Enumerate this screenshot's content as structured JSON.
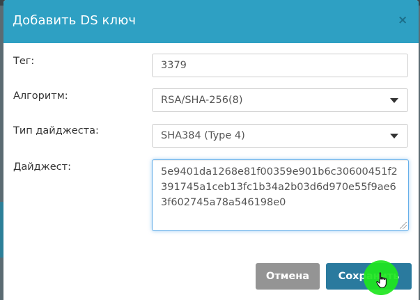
{
  "modal": {
    "title": "Добавить DS ключ",
    "close_symbol": "×"
  },
  "form": {
    "tag": {
      "label": "Тег:",
      "value": "3379"
    },
    "algorithm": {
      "label": "Алгоритм:",
      "selected": "RSA/SHA-256(8)"
    },
    "digest_type": {
      "label": "Тип дайджеста:",
      "selected": "SHA384 (Type 4)"
    },
    "digest": {
      "label": "Дайджест:",
      "value": "5e9401da1268e81f00359e901b6c30600451f2391745a1ceb13fc1b34a2b03d6d970e55f9ae63f602745a78a546198e0"
    }
  },
  "buttons": {
    "cancel_label": "Отмена",
    "save_label": "Сохранить"
  },
  "colors": {
    "header": "#2ea0c3",
    "save_button": "#2a7a9e",
    "cancel_button": "#949494",
    "focus_border": "#66afe9",
    "click_indicator": "#1ee61e"
  },
  "icons": {
    "close": "close-icon",
    "select_caret": "chevron-down-icon",
    "cursor": "hand-pointer-icon"
  }
}
